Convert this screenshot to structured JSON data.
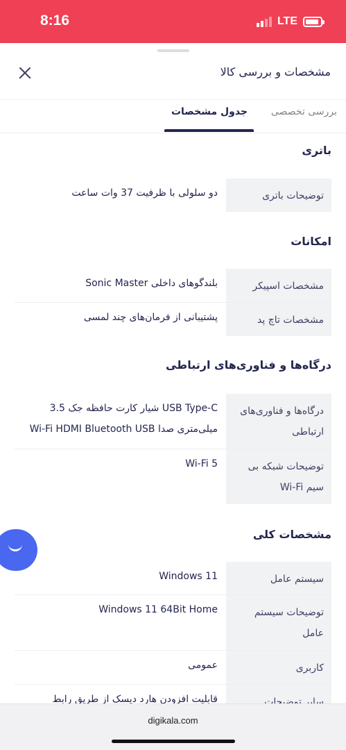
{
  "status_bar": {
    "time": "8:16",
    "network": "LTE",
    "signal_bars_filled": 2,
    "signal_bars_total": 4,
    "battery_level_fraction": 0.75,
    "color": "#ef4056"
  },
  "sheet": {
    "title": "مشخصات و بررسی کالا",
    "close_icon": "close-icon"
  },
  "tabs": [
    {
      "label": "جدول مشخصات",
      "active": true
    },
    {
      "label": "بررسی تخصصی",
      "active": false
    }
  ],
  "sections": [
    {
      "title": "باتری",
      "rows": [
        {
          "key": "توضیحات باتری",
          "value": "دو سلولی با ظرفیت 37 وات ساعت"
        }
      ]
    },
    {
      "title": "امکانات",
      "rows": [
        {
          "key": "مشخصات اسپیکر",
          "value": "بلندگوهای داخلی Sonic Master"
        },
        {
          "key": "مشخصات تاچ پد",
          "value": "پشتیبانی از فرمان‌های چند لمسی"
        }
      ]
    },
    {
      "title": "درگاه‌ها و فناوری‌های ارتباطی",
      "rows": [
        {
          "key": "درگاه‌ها و فناوری‌های ارتباطی",
          "value": "USB Type-C شیار کارت حافظه جک 3.5 میلی‌متری صدا Wi-Fi HDMI Bluetooth USB"
        },
        {
          "key": "توضیحات شبکه بی سیم Wi-Fi",
          "value": "Wi-Fi 5"
        }
      ]
    },
    {
      "title": "مشخصات کلی",
      "rows": [
        {
          "key": "سیستم عامل",
          "value": "Windows 11"
        },
        {
          "key": "توضیحات سیستم عامل",
          "value": "Windows 11 64Bit Home"
        },
        {
          "key": "کاربری",
          "value": "عمومی"
        },
        {
          "key": "سایر توضیحات",
          "value": "قابلیت افزودن هارد دیسک از طریق رابط"
        }
      ]
    }
  ],
  "chat_button": {
    "icon": "chat-smile-icon",
    "color": "#4a67f0"
  },
  "browser": {
    "url": "digikala.com"
  }
}
